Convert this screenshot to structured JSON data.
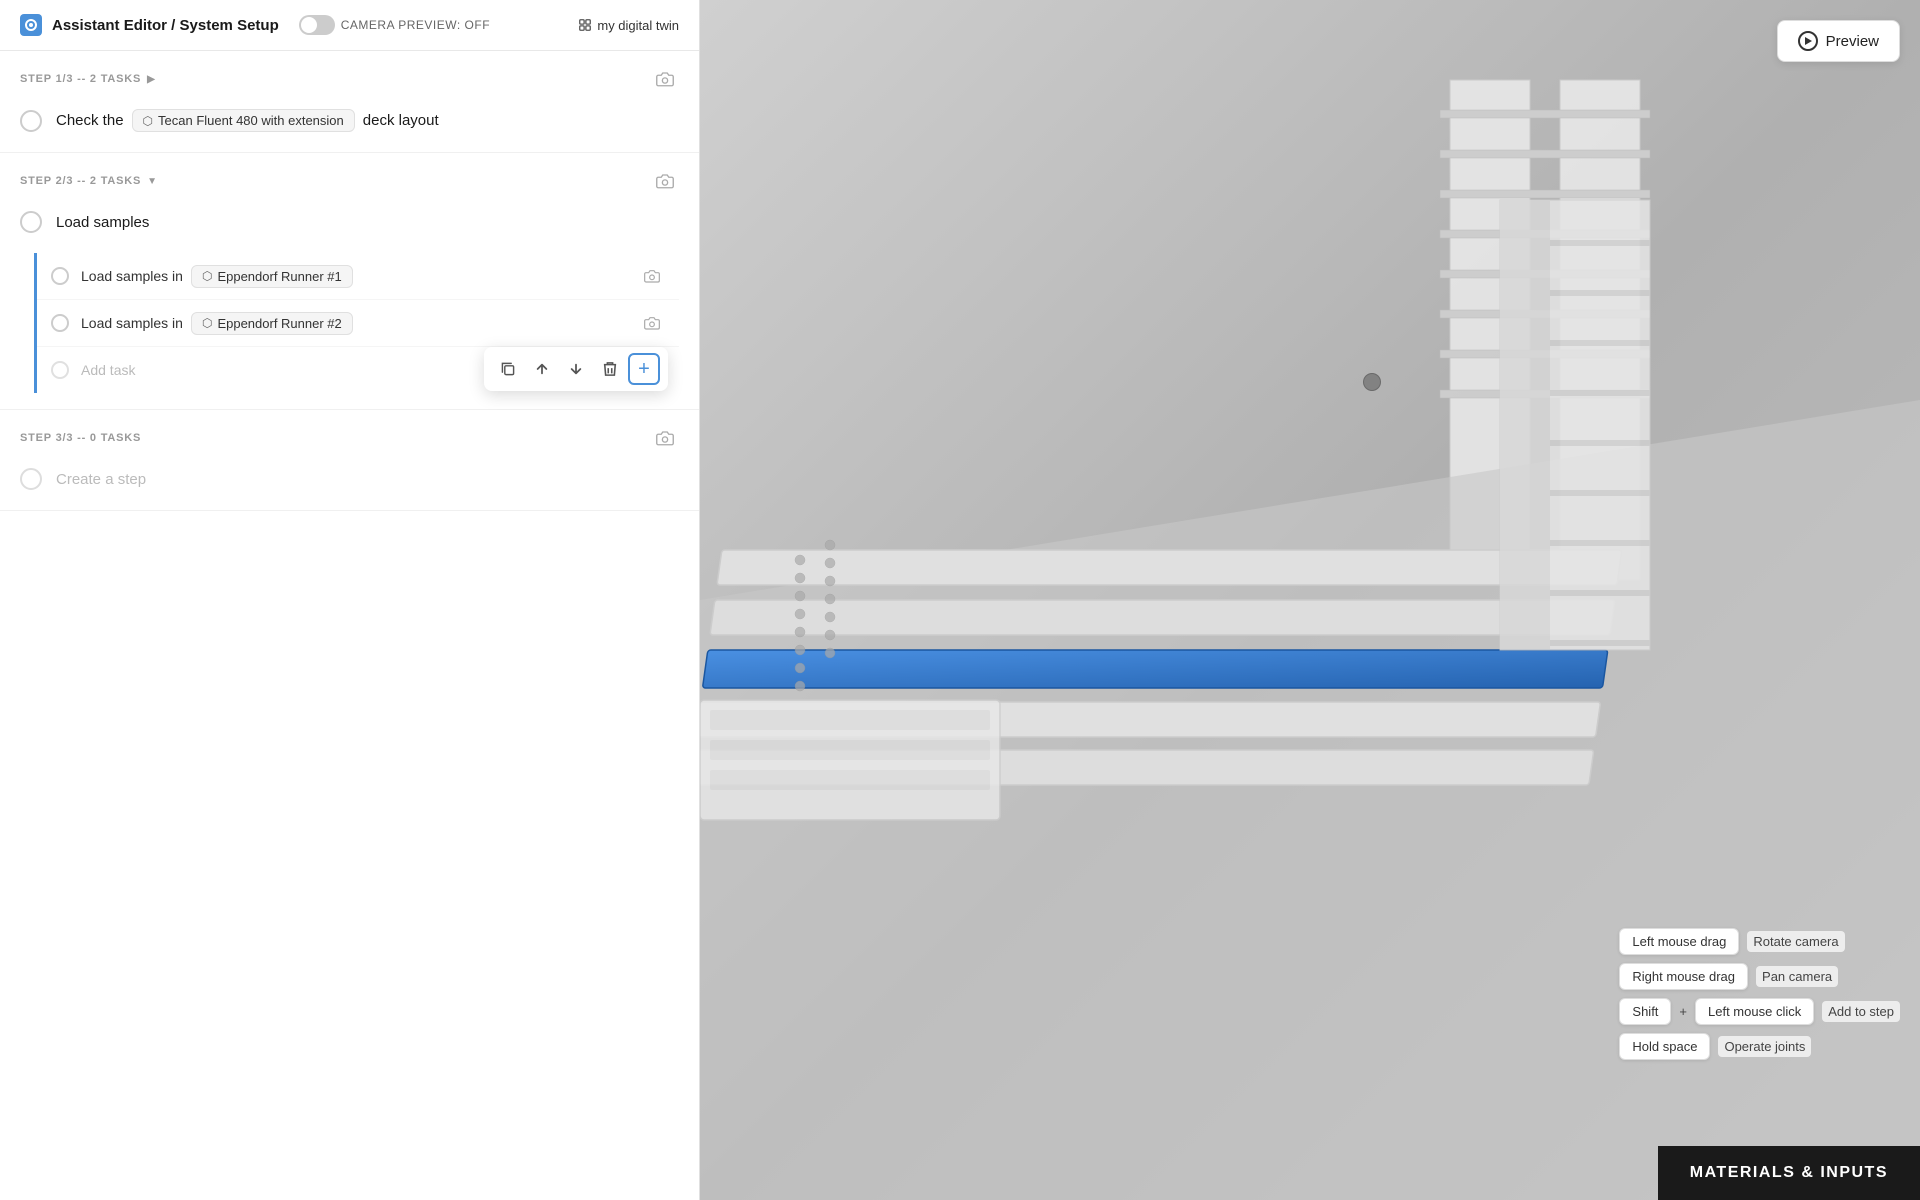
{
  "header": {
    "logo_icon": "assistant-icon",
    "title_prefix": "Assistant Editor / ",
    "title_main": "System Setup",
    "camera_label": "CAMERA PREVIEW: OFF",
    "digital_twin": "my digital twin",
    "toggle_state": "off"
  },
  "steps": [
    {
      "id": "step1",
      "label": "STEP 1/3 -- 2 TASKS",
      "arrow": "▶",
      "task": "Check the",
      "device_badge": "Tecan Fluent 480 with extension",
      "task_suffix": "deck layout",
      "subtasks": [],
      "show_subtasks": false
    },
    {
      "id": "step2",
      "label": "STEP 2/3 -- 2 TASKS",
      "arrow": "▼",
      "task": "Load samples",
      "subtasks": [
        {
          "text": "Load samples in",
          "badge": "Eppendorf Runner #1"
        },
        {
          "text": "Load samples in",
          "badge": "Eppendorf Runner #2"
        },
        {
          "text": "",
          "placeholder": "Add task",
          "is_add": true
        }
      ]
    },
    {
      "id": "step3",
      "label": "STEP 3/3 -- 0 TASKS",
      "task": "Create a step",
      "disabled": true
    }
  ],
  "floating_toolbar": {
    "buttons": [
      "duplicate",
      "up",
      "down",
      "delete",
      "add"
    ]
  },
  "preview_button": {
    "label": "Preview"
  },
  "controls": [
    {
      "key": "Left mouse drag",
      "description": "Rotate camera"
    },
    {
      "key": "Right mouse drag",
      "description": "Pan camera"
    },
    {
      "key_parts": [
        "Shift",
        "+",
        "Left mouse click"
      ],
      "description": "Add to step",
      "multi_key": true
    },
    {
      "key": "Hold space",
      "description": "Operate joints"
    }
  ],
  "materials_bar": {
    "label": "MATERIALS & INPUTS"
  },
  "icons": {
    "camera": "📷",
    "device": "⬡",
    "link": "🔗"
  }
}
